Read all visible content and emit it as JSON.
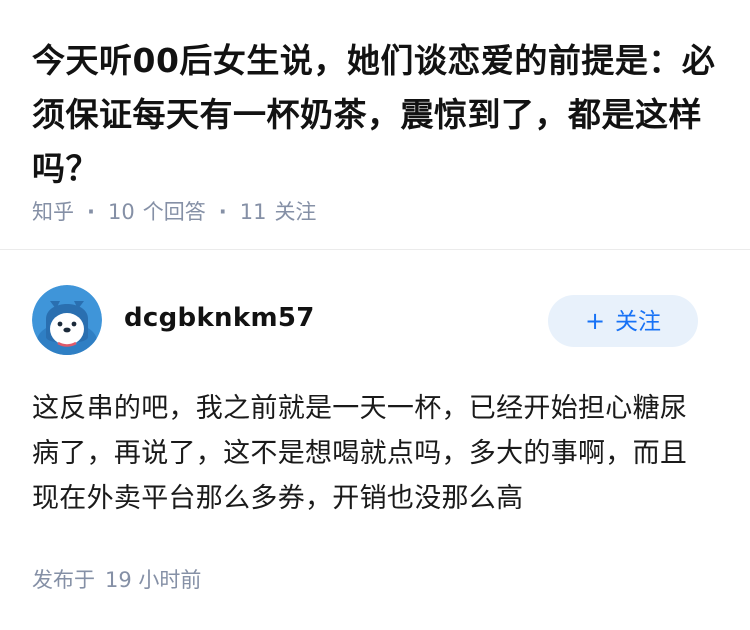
{
  "question": {
    "title": "今天听00后女生说，她们谈恋爱的前提是：必须保证每天有一杯奶茶，震惊到了，都是这样吗？",
    "source": "知乎",
    "answer_count": "10",
    "answer_label": "个回答",
    "follower_count": "11",
    "follower_label": "关注"
  },
  "answer": {
    "author": {
      "username": "dcgbknkm57",
      "avatar": "penguin-avatar-icon"
    },
    "follow_button": {
      "icon": "+",
      "label": "关注"
    },
    "content": "这反串的吧，我之前就是一天一杯，已经开始担心糖尿病了，再说了，这不是想喝就点吗，多大的事啊，而且现在外卖平台那么多券，开销也没那么高",
    "time_prefix": "发布于",
    "time_value": "19 小时前"
  },
  "colors": {
    "title": "#121212",
    "meta": "#8590a6",
    "accent": "#1772f6",
    "follow_bg": "#e8f1fb",
    "avatar_bg": "#3f95d9"
  }
}
